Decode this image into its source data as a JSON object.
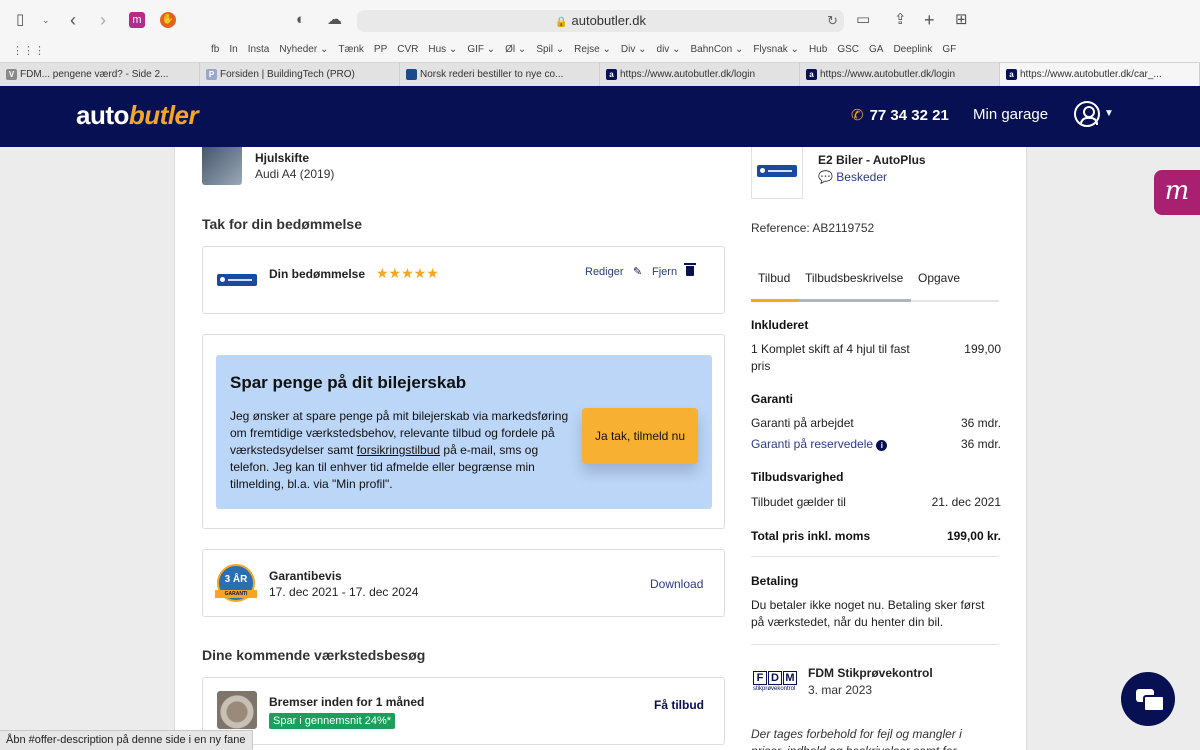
{
  "browser": {
    "url": "autobutler.dk",
    "favorites": [
      "fb",
      "In",
      "Insta",
      "Nyheder ⌄",
      "Tænk",
      "PP",
      "CVR",
      "Hus ⌄",
      "GIF ⌄",
      "Øl ⌄",
      "Spil ⌄",
      "Rejse ⌄",
      "Div ⌄",
      "div ⌄",
      "BahnCon ⌄",
      "Flysnak ⌄",
      "Hub",
      "GSC",
      "GA",
      "Deeplink",
      "GF"
    ],
    "tabs": [
      {
        "label": "FDM... pengene værd? - Side 2...",
        "fav": "V",
        "color": "#8a8a8a"
      },
      {
        "label": "Forsiden | BuildingTech (PRO)",
        "fav": "P",
        "color": "#9aa7c8"
      },
      {
        "label": "Norsk rederi bestiller to nye co...",
        "fav": "",
        "color": "#1c4a8a"
      },
      {
        "label": "https://www.autobutler.dk/login",
        "fav": "a",
        "color": "#071052"
      },
      {
        "label": "https://www.autobutler.dk/login",
        "fav": "a",
        "color": "#071052"
      },
      {
        "label": "https://www.autobutler.dk/car_...",
        "fav": "a",
        "color": "#071052"
      }
    ],
    "status_text": "Åbn #offer-description på denne side i en ny fane"
  },
  "header": {
    "logo_auto": "auto",
    "logo_butler": "butler",
    "phone": "77 34 32 21",
    "garage": "Min garage"
  },
  "job": {
    "title": "Hjulskifte",
    "car": "Audi A4 (2019)"
  },
  "rating": {
    "heading": "Tak for din bedømmelse",
    "label": "Din bedømmelse",
    "stars": "★★★★★",
    "stars_value": 5,
    "edit": "Rediger",
    "remove": "Fjern"
  },
  "promo": {
    "title": "Spar penge på dit bilejerskab",
    "text_before": "Jeg ønsker at spare penge på mit bilejerskab via markedsføring om fremtidige værkstedsbehov, relevante tilbud og fordele på værkstedsydelser samt ",
    "link": "forsikringstilbud",
    "text_after": " på e-mail, sms og telefon. Jeg kan til enhver tid afmelde eller begrænse min tilmelding, bl.a. via \"Min profil\".",
    "button": "Ja tak, tilmeld nu"
  },
  "warranty": {
    "badge": "3 ÅR",
    "title": "Garantibevis",
    "dates": "17. dec 2021 - 17. dec 2024",
    "download": "Download"
  },
  "upcoming": {
    "heading": "Dine kommende værkstedsbesøg",
    "title": "Bremser inden for 1 måned",
    "savings": "Spar i gennemsnit 24%*",
    "cta": "Få tilbud"
  },
  "shop": {
    "name": "E2 Biler - AutoPlus",
    "messages": "Beskeder",
    "reference": "Reference: AB2119752"
  },
  "offer_tabs": [
    "Tilbud",
    "Tilbudsbeskrivelse",
    "Opgave"
  ],
  "offer": {
    "included_heading": "Inkluderet",
    "included_item": "1 Komplet skift af 4 hjul til fast pris",
    "included_price": "199,00",
    "warranty_heading": "Garanti",
    "work_label": "Garanti på arbejdet",
    "work_value": "36 mdr.",
    "parts_label": "Garanti på reservedele",
    "parts_value": "36 mdr.",
    "validity_heading": "Tilbudsvarighed",
    "valid_label": "Tilbudet gælder til",
    "valid_value": "21. dec 2021",
    "total_label": "Total pris inkl. moms",
    "total_value": "199,00 kr.",
    "payment_heading": "Betaling",
    "payment_text": "Du betaler ikke noget nu. Betaling sker først på værkstedet, når du henter din bil."
  },
  "fdm": {
    "letters": [
      "F",
      "D",
      "M"
    ],
    "sub": "stikprøvekontrol",
    "title": "FDM Stikprøvekontrol",
    "date": "3. mar 2023",
    "disclaimer": "Der tages forbehold for fejl og mangler i priser, indhold og beskrivelser samt for"
  },
  "colors": {
    "navy": "#071052",
    "accent": "#f5a623",
    "promo_bg": "#bcd6f7",
    "green": "#1aa05a"
  }
}
